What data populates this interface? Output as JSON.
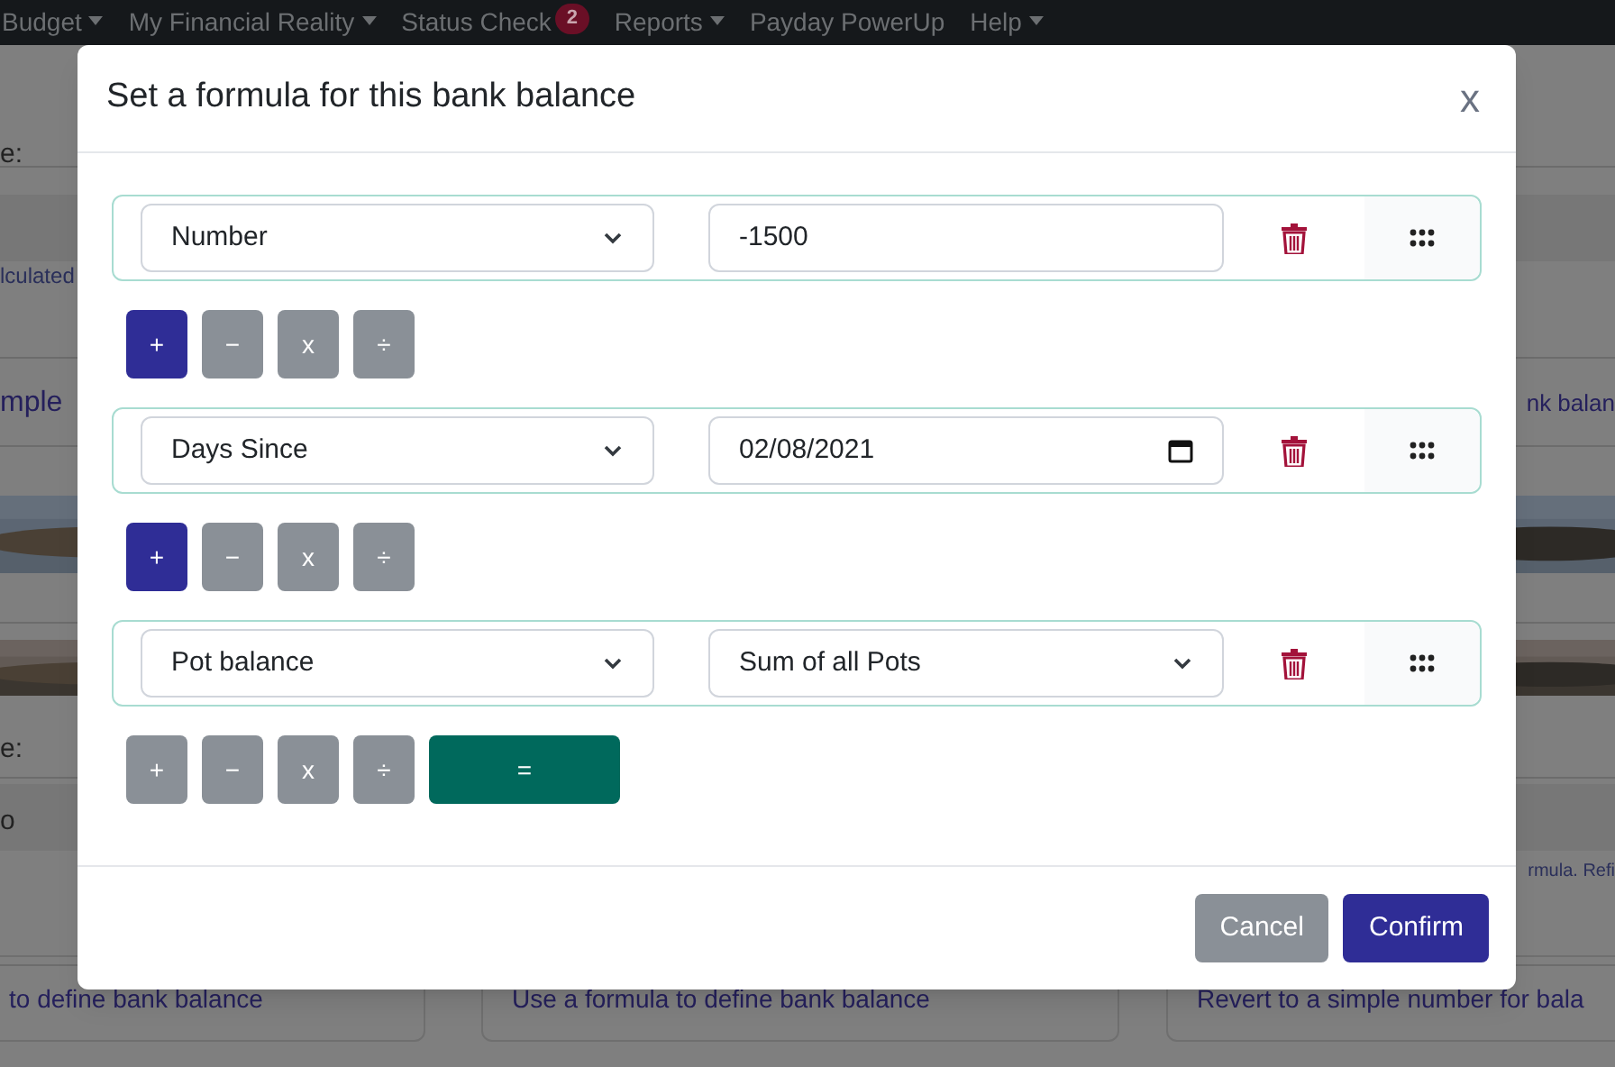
{
  "nav": [
    {
      "label": "Budget",
      "dropdown": true
    },
    {
      "label": "My Financial Reality",
      "dropdown": true
    },
    {
      "label": "Status Check",
      "badge": "2",
      "dropdown": false
    },
    {
      "label": "Reports",
      "dropdown": true
    },
    {
      "label": "Payday PowerUp",
      "dropdown": false
    },
    {
      "label": "Help",
      "dropdown": true
    }
  ],
  "background": {
    "left": [
      "e:",
      "lculated",
      "mple",
      "e:",
      "o"
    ],
    "right": [
      "nk balan",
      "rmula. Refi"
    ],
    "cards": [
      "to define bank balance",
      "Use a formula to define bank balance",
      "Revert to a simple number for bala"
    ]
  },
  "modal": {
    "title": "Set a formula for this bank balance",
    "close": "x",
    "rows": [
      {
        "kind": "number",
        "type": "Number",
        "value": "-1500",
        "operators": [
          {
            "symbol": "+",
            "selected": true
          },
          {
            "symbol": "−",
            "selected": false
          },
          {
            "symbol": "x",
            "selected": false
          },
          {
            "symbol": "÷",
            "selected": false
          }
        ]
      },
      {
        "kind": "date",
        "type": "Days Since",
        "value": "02/08/2021",
        "operators": [
          {
            "symbol": "+",
            "selected": true
          },
          {
            "symbol": "−",
            "selected": false
          },
          {
            "symbol": "x",
            "selected": false
          },
          {
            "symbol": "÷",
            "selected": false
          }
        ]
      },
      {
        "kind": "select",
        "type": "Pot balance",
        "value": "Sum of all Pots",
        "operators": [
          {
            "symbol": "+",
            "selected": false
          },
          {
            "symbol": "−",
            "selected": false
          },
          {
            "symbol": "x",
            "selected": false
          },
          {
            "symbol": "÷",
            "selected": false
          }
        ],
        "equals": "="
      }
    ],
    "buttons": [
      {
        "label": "Cancel",
        "kind": "secondary"
      },
      {
        "label": "Confirm",
        "kind": "primary"
      }
    ]
  }
}
